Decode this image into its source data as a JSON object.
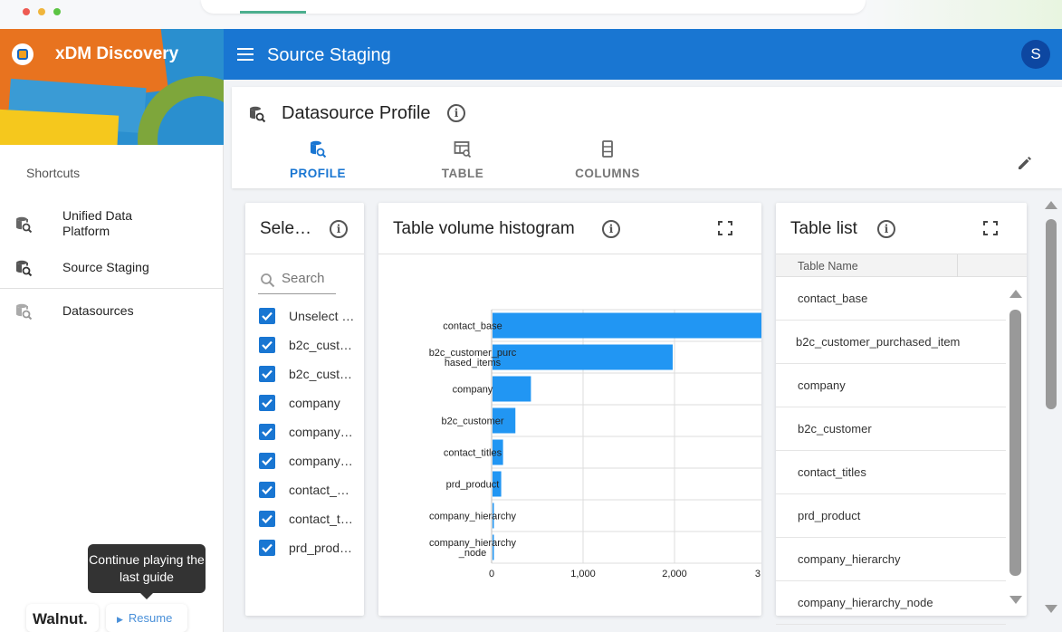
{
  "app": {
    "brand_title": "xDM Discovery",
    "page_title": "Source Staging",
    "avatar_initial": "S"
  },
  "sidebar": {
    "section_label": "Shortcuts",
    "items": [
      {
        "label": "Unified Data Platform",
        "icon": "database-search-icon"
      },
      {
        "label": "Source Staging",
        "icon": "database-search-icon"
      },
      {
        "label": "Datasources",
        "icon": "database-search-icon"
      }
    ]
  },
  "guide": {
    "tooltip": "Continue playing the last guide",
    "walnut_label": "Walnut.",
    "resume_label": "Resume"
  },
  "header": {
    "title": "Datasource Profile",
    "tabs": [
      {
        "label": "PROFILE",
        "active": true,
        "icon": "database-search-icon"
      },
      {
        "label": "TABLE",
        "active": false,
        "icon": "table-search-icon"
      },
      {
        "label": "COLUMNS",
        "active": false,
        "icon": "columns-icon"
      }
    ]
  },
  "select_panel": {
    "title": "Sele…",
    "search_placeholder": "Search",
    "items": [
      {
        "label": "Unselect …",
        "checked": true
      },
      {
        "label": "b2c_cust…",
        "checked": true
      },
      {
        "label": "b2c_cust…",
        "checked": true
      },
      {
        "label": "company",
        "checked": true
      },
      {
        "label": "company…",
        "checked": true
      },
      {
        "label": "company…",
        "checked": true
      },
      {
        "label": "contact_…",
        "checked": true
      },
      {
        "label": "contact_t…",
        "checked": true
      },
      {
        "label": "prd_prod…",
        "checked": true
      }
    ]
  },
  "histogram_panel": {
    "title": "Table volume histogram"
  },
  "chart_data": {
    "type": "bar",
    "orientation": "horizontal",
    "categories": [
      "contact_base",
      "b2c_customer_purchased_items",
      "company",
      "b2c_customer",
      "contact_titles",
      "prd_product",
      "company_hierarchy",
      "company_hierarchy_node"
    ],
    "category_labels": [
      [
        "contact_base"
      ],
      [
        "b2c_customer_purc",
        "hased_items"
      ],
      [
        "company"
      ],
      [
        "b2c_customer"
      ],
      [
        "contact_titles"
      ],
      [
        "prd_product"
      ],
      [
        "company_hierarchy"
      ],
      [
        "company_hierarchy",
        "_node"
      ]
    ],
    "values": [
      3000,
      1970,
      420,
      250,
      115,
      95,
      12,
      10
    ],
    "x_ticks": [
      0,
      1000,
      2000,
      3000
    ],
    "x_tick_labels": [
      "0",
      "1,000",
      "2,000",
      "3"
    ],
    "xlim": [
      0,
      2950
    ],
    "grid": true,
    "color": "#2196f3"
  },
  "table_list_panel": {
    "title": "Table list",
    "column_header": "Table Name",
    "rows": [
      "contact_base",
      "b2c_customer_purchased_item",
      "company",
      "b2c_customer",
      "contact_titles",
      "prd_product",
      "company_hierarchy",
      "company_hierarchy_node"
    ]
  }
}
